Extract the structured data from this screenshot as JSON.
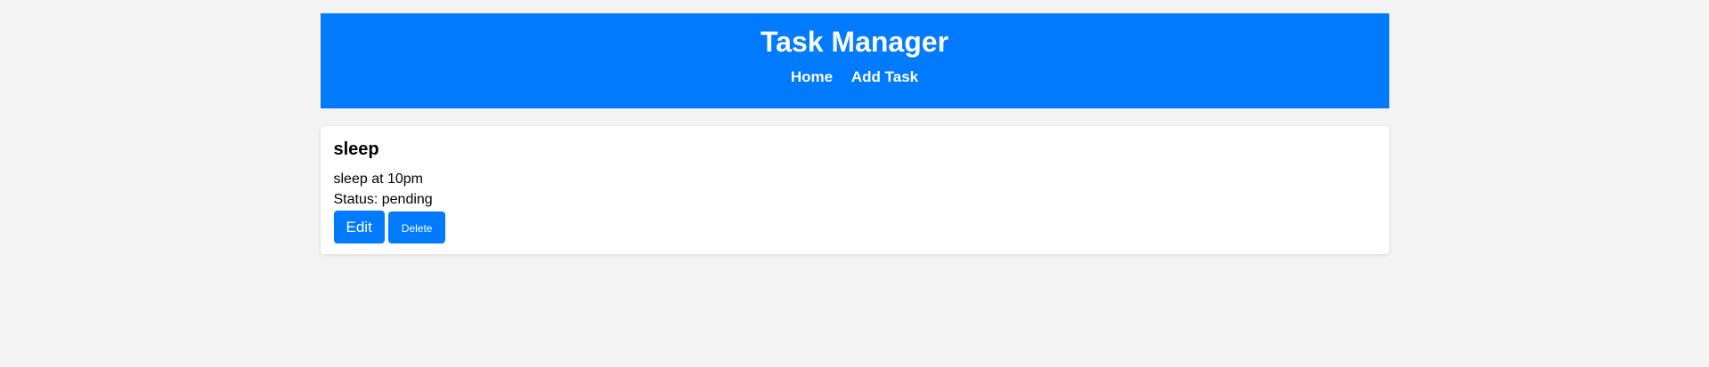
{
  "header": {
    "title": "Task Manager",
    "nav": [
      {
        "label": "Home"
      },
      {
        "label": "Add Task"
      }
    ]
  },
  "tasks": [
    {
      "title": "sleep",
      "description": "sleep at 10pm",
      "status_text": "Status: pending",
      "edit_label": "Edit",
      "delete_label": "Delete"
    }
  ],
  "colors": {
    "primary": "#007bff",
    "background": "#f3f3f3",
    "card": "#ffffff"
  }
}
